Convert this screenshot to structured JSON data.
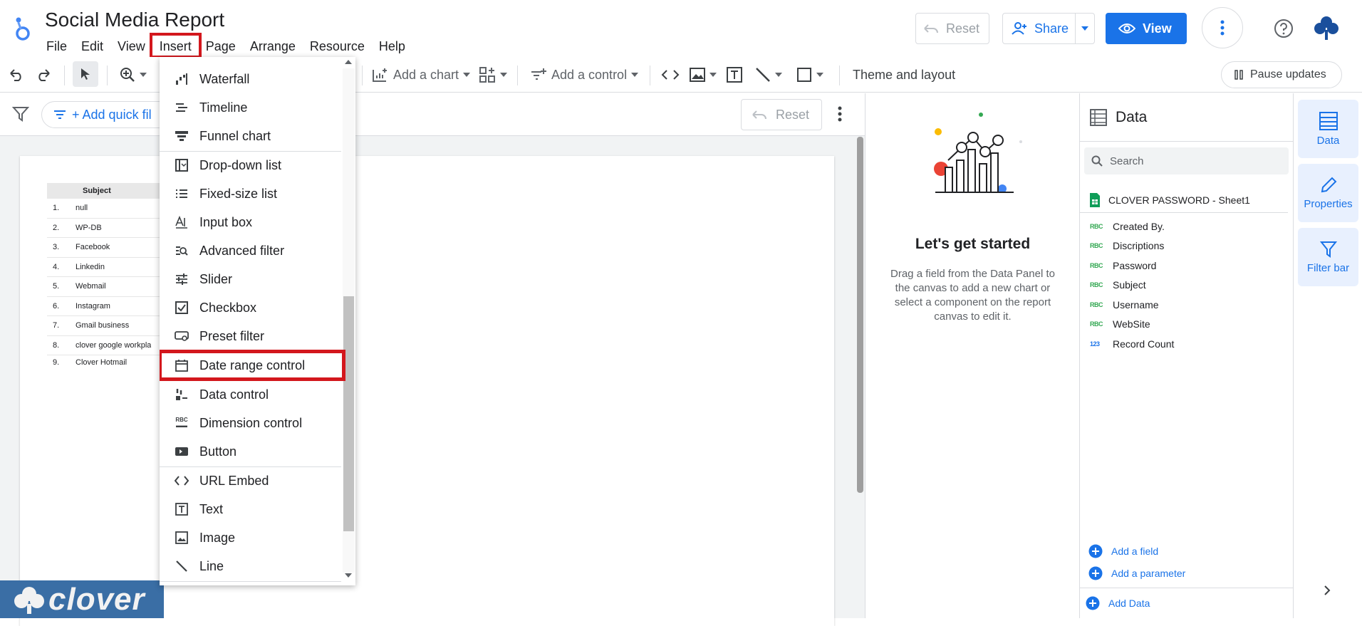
{
  "app": {
    "title": "Social Media Report",
    "menu": [
      "File",
      "Edit",
      "View",
      "Insert",
      "Page",
      "Arrange",
      "Resource",
      "Help"
    ],
    "active_menu": "Insert",
    "reset_label": "Reset",
    "share_label": "Share",
    "view_label": "View"
  },
  "toolbar": {
    "add_chart": "Add a chart",
    "add_control": "Add a control",
    "theme": "Theme and layout",
    "pause": "Pause updates"
  },
  "filterbar": {
    "quick_filter": "+ Add quick fil",
    "reset": "Reset"
  },
  "report_table": {
    "header": "Subject",
    "rows": [
      {
        "n": "1.",
        "s": "null"
      },
      {
        "n": "2.",
        "s": "WP-DB"
      },
      {
        "n": "3.",
        "s": "Facebook"
      },
      {
        "n": "4.",
        "s": "Linkedin"
      },
      {
        "n": "5.",
        "s": "Webmail"
      },
      {
        "n": "6.",
        "s": "Instagram"
      },
      {
        "n": "7.",
        "s": "Gmail business"
      },
      {
        "n": "8.",
        "s": "clover google workpla"
      },
      {
        "n": "9.",
        "s": "Clover Hotmail"
      }
    ]
  },
  "watermark": "clover",
  "insert_menu": {
    "items": [
      {
        "label": "Waterfall",
        "icon": "waterfall-icon"
      },
      {
        "label": "Timeline",
        "icon": "timeline-icon"
      },
      {
        "label": "Funnel chart",
        "icon": "funnel-icon"
      },
      {
        "label": "Drop-down list",
        "icon": "dropdown-list-icon"
      },
      {
        "label": "Fixed-size list",
        "icon": "list-icon"
      },
      {
        "label": "Input box",
        "icon": "input-box-icon"
      },
      {
        "label": "Advanced filter",
        "icon": "advanced-filter-icon"
      },
      {
        "label": "Slider",
        "icon": "slider-icon"
      },
      {
        "label": "Checkbox",
        "icon": "checkbox-icon"
      },
      {
        "label": "Preset filter",
        "icon": "preset-filter-icon"
      },
      {
        "label": "Date range control",
        "icon": "calendar-icon"
      },
      {
        "label": "Data control",
        "icon": "data-control-icon"
      },
      {
        "label": "Dimension control",
        "icon": "dimension-icon"
      },
      {
        "label": "Button",
        "icon": "button-icon"
      },
      {
        "label": "URL Embed",
        "icon": "code-icon"
      },
      {
        "label": "Text",
        "icon": "text-icon"
      },
      {
        "label": "Image",
        "icon": "image-icon"
      },
      {
        "label": "Line",
        "icon": "line-icon"
      }
    ],
    "highlighted": "Date range control"
  },
  "get_started": {
    "title": "Let's get started",
    "text": "Drag a field from the Data Panel to the canvas to add a new chart or select a component on the report canvas to edit it."
  },
  "data_panel": {
    "title": "Data",
    "search_placeholder": "Search",
    "source": "CLOVER PASSWORD - Sheet1",
    "fields": [
      {
        "type": "RBC",
        "name": "Created By."
      },
      {
        "type": "RBC",
        "name": "Discriptions"
      },
      {
        "type": "RBC",
        "name": "Password"
      },
      {
        "type": "RBC",
        "name": "Subject"
      },
      {
        "type": "RBC",
        "name": "Username"
      },
      {
        "type": "RBC",
        "name": "WebSite"
      },
      {
        "type": "123",
        "name": "Record Count"
      }
    ],
    "add_field": "Add a field",
    "add_parameter": "Add a parameter",
    "add_data": "Add Data"
  },
  "rail": {
    "data": "Data",
    "properties": "Properties",
    "filter_bar": "Filter bar"
  },
  "colors": {
    "accent": "#1a73e8",
    "highlight_red": "#d3171d",
    "watermark_bg": "#3a6ea5"
  }
}
